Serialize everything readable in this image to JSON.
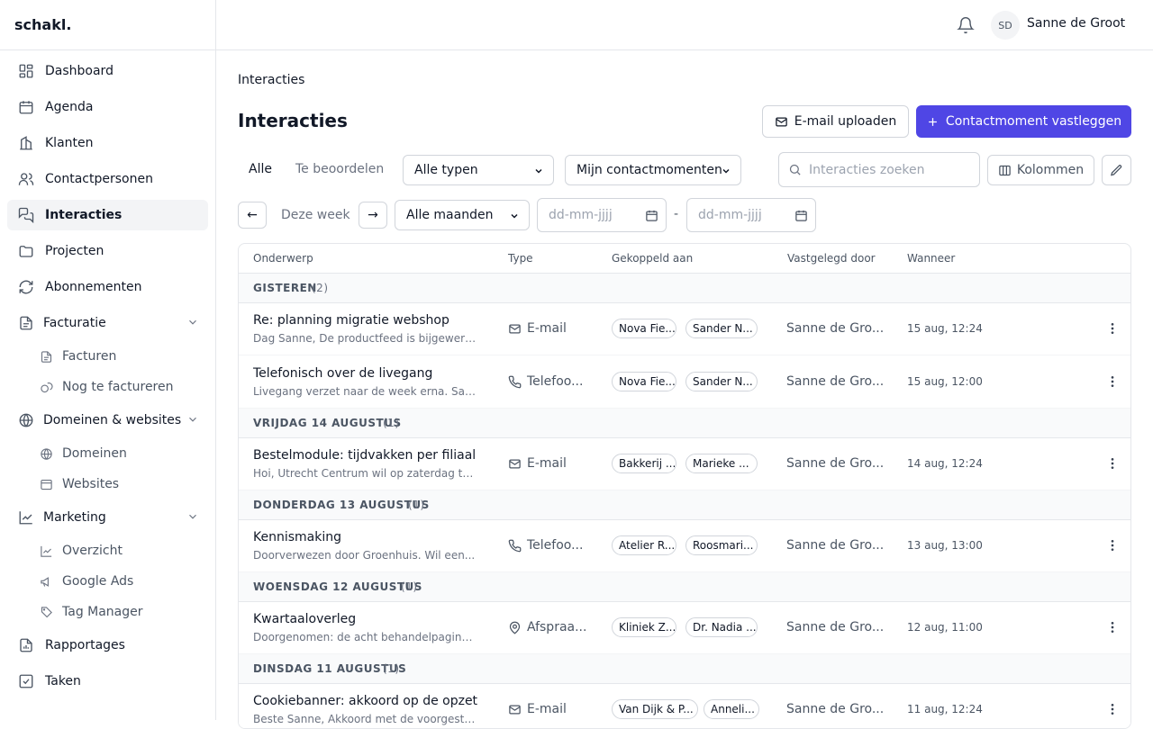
{
  "app": {
    "brand": "schakl."
  },
  "user": {
    "initials": "SD",
    "name": "Sanne de Groot"
  },
  "sidebar": {
    "items": [
      {
        "label": "Dashboard",
        "icon": "dashboard-icon"
      },
      {
        "label": "Agenda",
        "icon": "calendar-icon"
      },
      {
        "label": "Klanten",
        "icon": "building-icon"
      },
      {
        "label": "Contactpersonen",
        "icon": "users-icon"
      },
      {
        "label": "Interacties",
        "icon": "chat-icon",
        "active": true
      },
      {
        "label": "Projecten",
        "icon": "folder-icon"
      },
      {
        "label": "Abonnementen",
        "icon": "refresh-icon"
      },
      {
        "label": "Facturatie",
        "icon": "document-icon"
      },
      {
        "label": "Facturen",
        "icon": "file-icon"
      },
      {
        "label": "Nog te factureren",
        "icon": "coins-icon"
      },
      {
        "label": "Domeinen & websites",
        "icon": "globe-icon"
      },
      {
        "label": "Domeinen",
        "icon": "globe-icon"
      },
      {
        "label": "Websites",
        "icon": "browser-icon"
      },
      {
        "label": "Marketing",
        "icon": "chart-line-icon"
      },
      {
        "label": "Overzicht",
        "icon": "chart-line-icon"
      },
      {
        "label": "Google Ads",
        "icon": "megaphone-icon"
      },
      {
        "label": "Tag Manager",
        "icon": "tag-icon"
      },
      {
        "label": "Rapportages",
        "icon": "report-icon"
      },
      {
        "label": "Taken",
        "icon": "checkbox-icon"
      }
    ]
  },
  "page": {
    "breadcrumb": "Interacties",
    "title": "Interacties",
    "upload_button": "E-mail uploaden",
    "record_button": "Contactmoment vastleggen",
    "tabs": [
      "Alle",
      "Te beoordelen"
    ],
    "type_filter": "Alle typen",
    "owner_filter": "Mijn contactmomenten",
    "search_placeholder": "Interacties zoeken",
    "columns_button": "Kolommen",
    "week_prev": "←",
    "week_label": "Deze week",
    "week_next": "→",
    "month_filter": "Alle maanden",
    "date_from_placeholder": "dd-mm-jjjj",
    "date_separator": "-",
    "date_to_placeholder": "dd-mm-jjjj"
  },
  "table": {
    "headers": [
      "Onderwerp",
      "Type",
      "Gekoppeld aan",
      "Vastgelegd door",
      "Wanneer"
    ],
    "groups": [
      {
        "label": "GISTEREN",
        "count": "(2)",
        "rows": [
          {
            "subject": "Re: planning migratie webshop",
            "preview": "Dag Sanne, De productfeed is bijgewerkt z...",
            "type": "E-mail",
            "type_icon": "mail-icon",
            "chips": [
              "Nova Fie...",
              "Sander N..."
            ],
            "by": "Sanne de Gro...",
            "when": "15 aug, 12:24"
          },
          {
            "subject": "Telefonisch over de livegang",
            "preview": "Livegang verzet naar de week erna. Sande...",
            "type": "Telefoo...",
            "type_icon": "phone-icon",
            "chips": [
              "Nova Fie...",
              "Sander N..."
            ],
            "by": "Sanne de Gro...",
            "when": "15 aug, 12:00"
          }
        ]
      },
      {
        "label": "VRIJDAG 14 AUGUSTUS",
        "count": "(1)",
        "rows": [
          {
            "subject": "Bestelmodule: tijdvakken per filiaal",
            "preview": "Hoi, Utrecht Centrum wil op zaterdag tot 1...",
            "type": "E-mail",
            "type_icon": "mail-icon",
            "chips": [
              "Bakkerij ...",
              "Marieke ..."
            ],
            "by": "Sanne de Gro...",
            "when": "14 aug, 12:24"
          }
        ]
      },
      {
        "label": "DONDERDAG 13 AUGUSTUS",
        "count": "(1)",
        "rows": [
          {
            "subject": "Kennismaking",
            "preview": "Doorverwezen door Groenhuis. Wil een...",
            "type": "Telefoo...",
            "type_icon": "phone-icon",
            "chips": [
              "Atelier R...",
              "Roosmari..."
            ],
            "by": "Sanne de Gro...",
            "when": "13 aug, 13:00"
          }
        ]
      },
      {
        "label": "WOENSDAG 12 AUGUSTUS",
        "count": "(1)",
        "rows": [
          {
            "subject": "Kwartaaloverleg",
            "preview": "Doorgenomen: de acht behandelpagina's, ...",
            "type": "Afspraa...",
            "type_icon": "location-icon",
            "chips": [
              "Kliniek Z...",
              "Dr. Nadia ..."
            ],
            "by": "Sanne de Gro...",
            "when": "12 aug, 11:00"
          }
        ]
      },
      {
        "label": "DINSDAG 11 AUGUSTUS",
        "count": "(1)",
        "rows": [
          {
            "subject": "Cookiebanner: akkoord op de opzet",
            "preview": "Beste Sanne, Akkoord met de voorgesteld...",
            "type": "E-mail",
            "type_icon": "mail-icon",
            "chips": [
              "Van Dijk & P...",
              "Anneli..."
            ],
            "by": "Sanne de Gro...",
            "when": "11 aug, 12:24"
          }
        ]
      }
    ]
  },
  "colors": {
    "primary": "#4f46e5",
    "border": "#e5e7eb",
    "group_bg": "#f9fafb",
    "active_nav": "#f3f4f6"
  }
}
